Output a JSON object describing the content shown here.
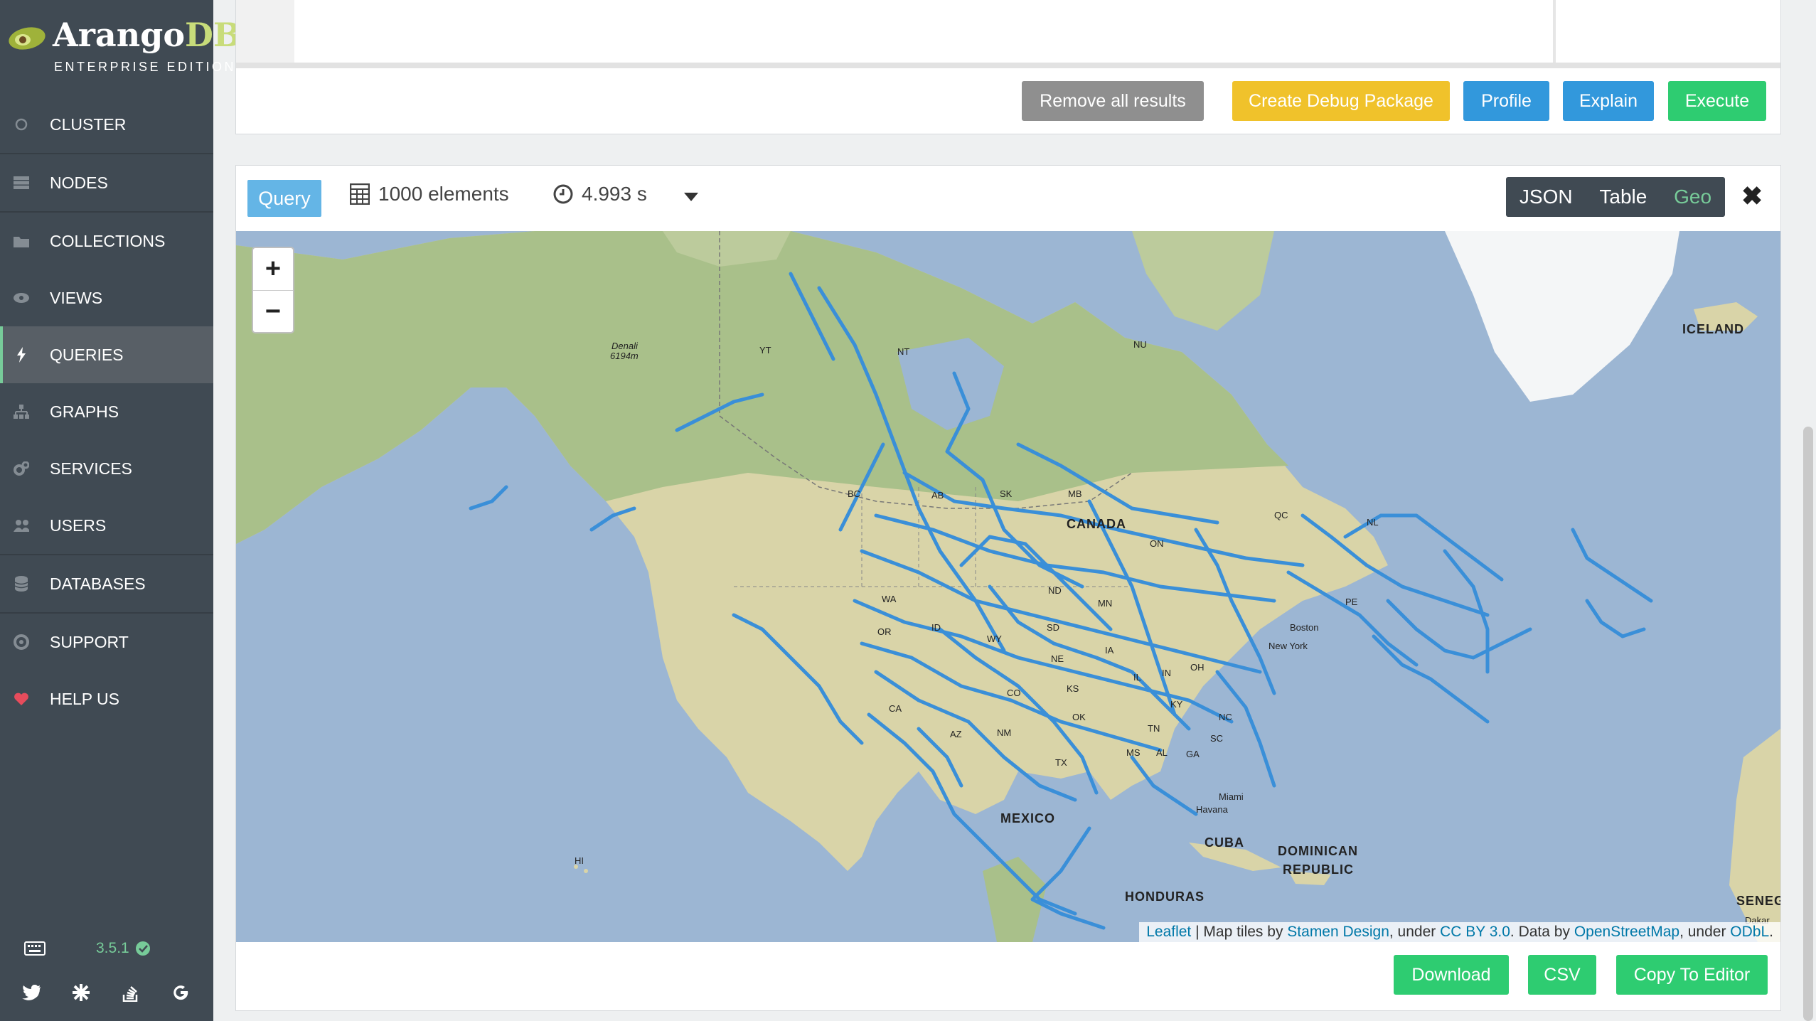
{
  "brand": {
    "name_a": "Arango",
    "name_b": "DB",
    "edition": "ENTERPRISE EDITION"
  },
  "sidebar": {
    "items": [
      {
        "label": "CLUSTER",
        "icon": "circle-icon"
      },
      {
        "label": "NODES",
        "icon": "server-icon"
      },
      {
        "label": "COLLECTIONS",
        "icon": "folder-icon"
      },
      {
        "label": "VIEWS",
        "icon": "eye-icon"
      },
      {
        "label": "QUERIES",
        "icon": "bolt-icon",
        "active": true
      },
      {
        "label": "GRAPHS",
        "icon": "sitemap-icon"
      },
      {
        "label": "SERVICES",
        "icon": "cogs-icon"
      },
      {
        "label": "USERS",
        "icon": "users-icon"
      },
      {
        "label": "DATABASES",
        "icon": "database-icon"
      },
      {
        "label": "SUPPORT",
        "icon": "life-ring-icon"
      },
      {
        "label": "HELP US",
        "icon": "heart-icon"
      }
    ],
    "version": "3.5.1"
  },
  "editor_toolbar": {
    "remove_label": "Remove all results",
    "debug_label": "Create Debug Package",
    "profile_label": "Profile",
    "explain_label": "Explain",
    "execute_label": "Execute"
  },
  "result": {
    "tag": "Query",
    "elements": "1000 elements",
    "time": "4.993 s",
    "views": {
      "json": "JSON",
      "table": "Table",
      "geo": "Geo"
    },
    "active_view": "Geo"
  },
  "map": {
    "labels": [
      {
        "text": "ICELAND"
      },
      {
        "text": "CANADA"
      },
      {
        "text": "MEXICO"
      },
      {
        "text": "CUBA"
      },
      {
        "text": "DOMINICAN"
      },
      {
        "text": "REPUBLIC"
      },
      {
        "text": "HONDURAS"
      },
      {
        "text": "SENEG"
      },
      {
        "text": "NU"
      },
      {
        "text": "NT"
      },
      {
        "text": "YT"
      },
      {
        "text": "BC"
      },
      {
        "text": "AB"
      },
      {
        "text": "SK"
      },
      {
        "text": "MB"
      },
      {
        "text": "ON"
      },
      {
        "text": "QC"
      },
      {
        "text": "NL"
      },
      {
        "text": "PE"
      },
      {
        "text": "WA"
      },
      {
        "text": "OR"
      },
      {
        "text": "ID"
      },
      {
        "text": "WY"
      },
      {
        "text": "SD"
      },
      {
        "text": "ND"
      },
      {
        "text": "MN"
      },
      {
        "text": "NE"
      },
      {
        "text": "CO"
      },
      {
        "text": "KS"
      },
      {
        "text": "OK"
      },
      {
        "text": "TX"
      },
      {
        "text": "NM"
      },
      {
        "text": "AZ"
      },
      {
        "text": "CA"
      },
      {
        "text": "IA"
      },
      {
        "text": "IL"
      },
      {
        "text": "IN"
      },
      {
        "text": "OH"
      },
      {
        "text": "KY"
      },
      {
        "text": "TN"
      },
      {
        "text": "MS"
      },
      {
        "text": "AL"
      },
      {
        "text": "GA"
      },
      {
        "text": "SC"
      },
      {
        "text": "NC"
      },
      {
        "text": "HI"
      },
      {
        "text": "Denali"
      },
      {
        "text": "6194m"
      },
      {
        "text": "Boston"
      },
      {
        "text": "New York"
      },
      {
        "text": "Miami"
      },
      {
        "text": "Havana"
      },
      {
        "text": "Dakar"
      }
    ],
    "zoom_in": "+",
    "zoom_out": "−",
    "attribution": {
      "leaflet": "Leaflet",
      "sep": " | Map tiles by ",
      "stamen": "Stamen Design",
      "under1": ", under ",
      "ccby": "CC BY 3.0",
      "data_by": ". Data by ",
      "osm": "OpenStreetMap",
      "under2": ", under ",
      "odbl": "ODbL",
      "end": "."
    }
  },
  "footer": {
    "download_label": "Download",
    "csv_label": "CSV",
    "copy_label": "Copy To Editor"
  },
  "colors": {
    "route": "#3a8fd8",
    "accent_green": "#2ecc71",
    "accent_blue": "#3298dc",
    "accent_yellow": "#f0c22b"
  }
}
